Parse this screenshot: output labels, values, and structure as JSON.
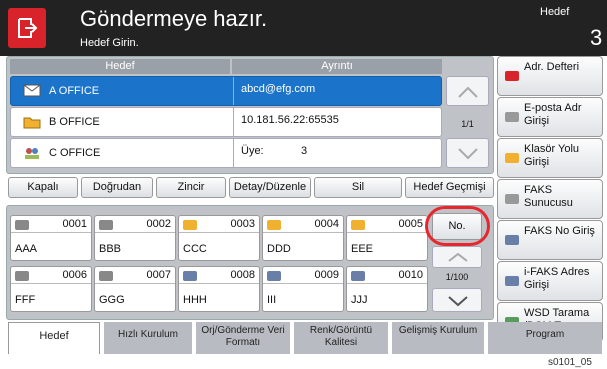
{
  "header": {
    "title": "Göndermeye hazır.",
    "subtitle": "Hedef Girin.",
    "dest_label": "Hedef",
    "dest_count": "3"
  },
  "table": {
    "col_dest": "Hedef",
    "col_detail": "Ayrıntı",
    "rows": [
      {
        "name": "A OFFICE",
        "detail": "abcd@efg.com",
        "icon": "email-icon"
      },
      {
        "name": "B OFFICE",
        "detail": "10.181.56.22:65535",
        "icon": "folder-icon"
      },
      {
        "name": "C OFFICE",
        "detail": "Üye:",
        "detail2": "3",
        "icon": "group-icon"
      }
    ],
    "page": "1/1"
  },
  "toolbar": {
    "close": "Kapalı",
    "direct": "Doğrudan",
    "chain": "Zincir",
    "detail_edit": "Detay/Düzenle",
    "delete": "Sil",
    "history": "Hedef Geçmişi"
  },
  "right_buttons": [
    {
      "label": "Adr. Defteri"
    },
    {
      "label": "E-posta Adr Girişi"
    },
    {
      "label": "Klasör Yolu Girişi"
    },
    {
      "label": "FAKS Sunucusu"
    },
    {
      "label": "FAKS No Giriş"
    },
    {
      "label": "i-FAKS Adres Girişi"
    },
    {
      "label": "WSD Tarama /DSM Tarma"
    }
  ],
  "onetouch": {
    "no_button": "No.",
    "page": "1/100",
    "keys": [
      {
        "num": "0001",
        "name": "AAA"
      },
      {
        "num": "0002",
        "name": "BBB"
      },
      {
        "num": "0003",
        "name": "CCC"
      },
      {
        "num": "0004",
        "name": "DDD"
      },
      {
        "num": "0005",
        "name": "EEE"
      },
      {
        "num": "0006",
        "name": "FFF"
      },
      {
        "num": "0007",
        "name": "GGG"
      },
      {
        "num": "0008",
        "name": "HHH"
      },
      {
        "num": "0009",
        "name": "III"
      },
      {
        "num": "0010",
        "name": "JJJ"
      }
    ]
  },
  "tabs": [
    {
      "label": "Hedef"
    },
    {
      "label": "Hızlı Kurulum"
    },
    {
      "label": "Orj/Gönderme Veri Formatı"
    },
    {
      "label": "Renk/Görüntü Kalitesi"
    },
    {
      "label": "Gelişmiş Kurulum"
    },
    {
      "label": "Program"
    }
  ],
  "figure_code": "s0101_05",
  "colors": {
    "accent": "#d9232b",
    "selected": "#1b74c9"
  }
}
